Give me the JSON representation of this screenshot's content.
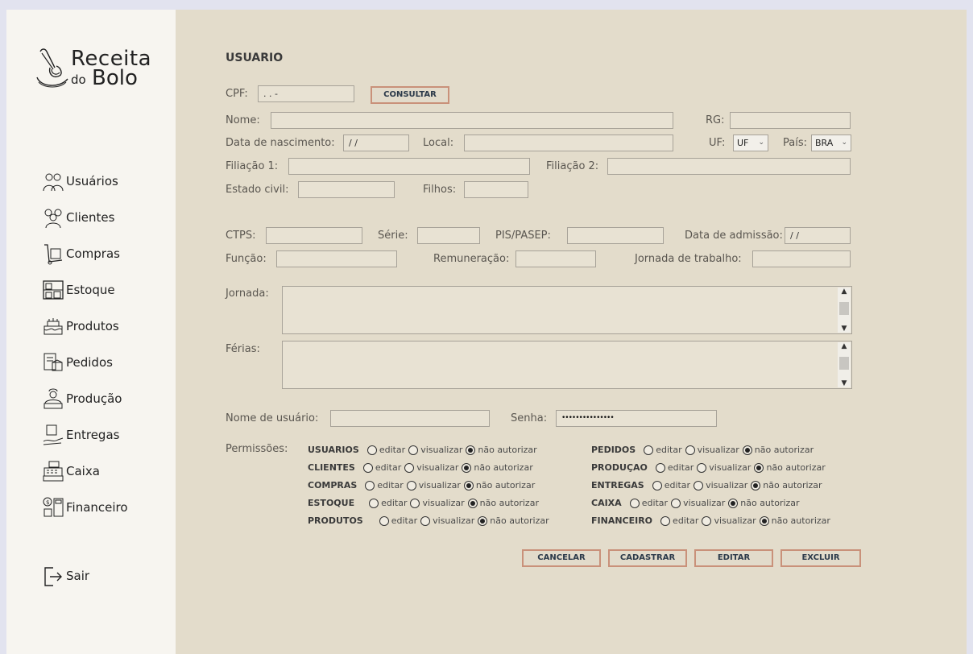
{
  "app": {
    "logo_line1": "Receita",
    "logo_line2": "do",
    "logo_line3": "Bolo"
  },
  "sidebar": {
    "items": [
      {
        "label": "Usuários",
        "icon": "users-icon"
      },
      {
        "label": "Clientes",
        "icon": "clients-icon"
      },
      {
        "label": "Compras",
        "icon": "hand-truck-icon"
      },
      {
        "label": "Estoque",
        "icon": "shelves-icon"
      },
      {
        "label": "Produtos",
        "icon": "cake-icon"
      },
      {
        "label": "Pedidos",
        "icon": "order-box-icon"
      },
      {
        "label": "Produção",
        "icon": "baker-icon"
      },
      {
        "label": "Entregas",
        "icon": "delivery-icon"
      },
      {
        "label": "Caixa",
        "icon": "cash-register-icon"
      },
      {
        "label": "Financeiro",
        "icon": "calculator-icon"
      }
    ],
    "exit_label": "Sair"
  },
  "form": {
    "title": "USUARIO",
    "cpf_label": "CPF:",
    "cpf_value": " . . -",
    "consultar": "CONSULTAR",
    "nome_label": "Nome:",
    "rg_label": "RG:",
    "nasc_label": "Data de nascimento:",
    "nasc_value": " / /",
    "local_label": "Local:",
    "uf_label": "UF:",
    "uf_value": "UF",
    "pais_label": "País:",
    "pais_value": "BRA",
    "filiacao1_label": "Filiação 1:",
    "filiacao2_label": "Filiação 2:",
    "estado_civil_label": "Estado civil:",
    "filhos_label": "Filhos:",
    "ctps_label": "CTPS:",
    "serie_label": "Série:",
    "pis_label": "PIS/PASEP:",
    "admissao_label": "Data de admissão:",
    "admissao_value": " / /",
    "funcao_label": "Função:",
    "remuneracao_label": "Remuneração:",
    "jornada_trab_label": "Jornada de trabalho:",
    "jornada_label": "Jornada:",
    "ferias_label": "Férias:",
    "usuario_label": "Nome de usuário:",
    "senha_label": "Senha:",
    "senha_value": "•••••••••••••••",
    "permissoes_label": "Permissões:"
  },
  "permissions": {
    "options": [
      "editar",
      "visualizar",
      "não autorizar"
    ],
    "left": [
      {
        "name": "USUARIOS",
        "selected": 2
      },
      {
        "name": "CLIENTES",
        "selected": 2
      },
      {
        "name": "COMPRAS",
        "selected": 2
      },
      {
        "name": "ESTOQUE",
        "selected": 2
      },
      {
        "name": "PRODUTOS",
        "selected": 2
      }
    ],
    "right": [
      {
        "name": "PEDIDOS",
        "selected": 2
      },
      {
        "name": "PRODUÇAO",
        "selected": 2
      },
      {
        "name": "ENTREGAS",
        "selected": 2
      },
      {
        "name": "CAIXA",
        "selected": 2
      },
      {
        "name": "FINANCEIRO",
        "selected": 2
      }
    ]
  },
  "actions": {
    "cancelar": "CANCELAR",
    "cadastrar": "CADASTRAR",
    "editar": "EDITAR",
    "excluir": "EXCLUIR"
  },
  "colors": {
    "sidebar_bg": "#f7f5f0",
    "main_bg": "#e3dccb",
    "button_border": "#c9917a",
    "page_bg": "#e2e3ef"
  }
}
